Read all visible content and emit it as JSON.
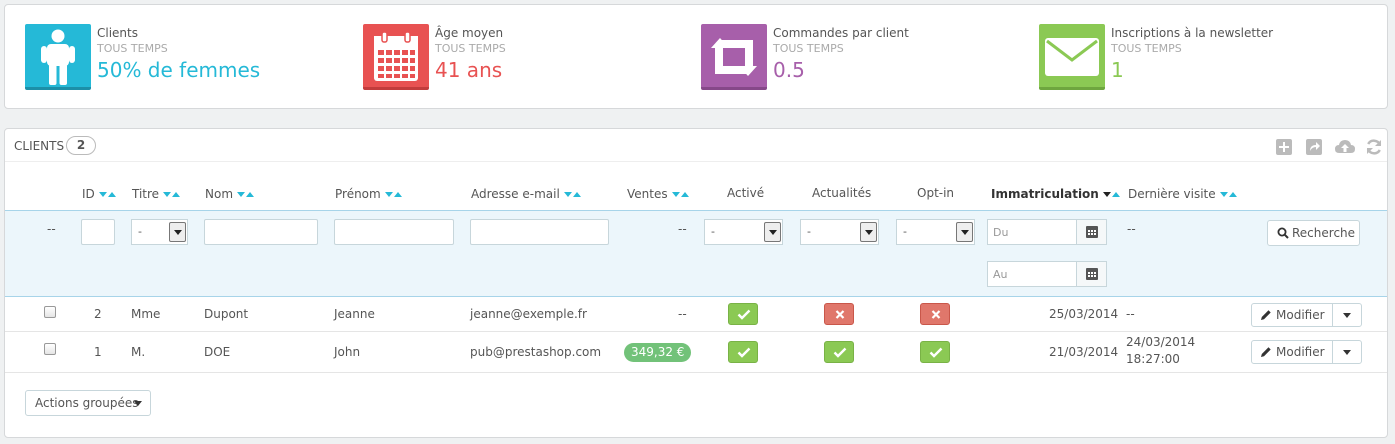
{
  "kpis": [
    {
      "title": "Clients",
      "period": "TOUS TEMPS",
      "value": "50% de femmes",
      "color": "#25b9d7",
      "icon": "user-icon"
    },
    {
      "title": "Âge moyen",
      "period": "TOUS TEMPS",
      "value": "41 ans",
      "color": "#e85252",
      "icon": "calendar-icon"
    },
    {
      "title": "Commandes par client",
      "period": "TOUS TEMPS",
      "value": "0.5",
      "color": "#a75faa",
      "icon": "retweet-icon"
    },
    {
      "title": "Inscriptions à la newsletter",
      "period": "TOUS TEMPS",
      "value": "1",
      "color": "#8bc954",
      "icon": "envelope-icon"
    }
  ],
  "panel": {
    "title": "CLIENTS",
    "count": "2",
    "toolbar": [
      "add-icon",
      "export-icon",
      "cloud-upload-icon",
      "refresh-icon"
    ]
  },
  "columns": {
    "id": "ID",
    "title": "Titre",
    "lastname": "Nom",
    "firstname": "Prénom",
    "email": "Adresse e-mail",
    "sales": "Ventes",
    "active": "Activé",
    "news": "Actualités",
    "optin": "Opt-in",
    "registration": "Immatriculation",
    "last_visit": "Dernière visite"
  },
  "filters": {
    "placeholder_dash": "--",
    "title_select": "-",
    "active_select": "-",
    "news_select": "-",
    "optin_select": "-",
    "sales_dash": "--",
    "date_from": "Du",
    "date_to": "Au",
    "last_visit_dash": "--",
    "search_label": "Recherche"
  },
  "rows": [
    {
      "id": "2",
      "title": "Mme",
      "lastname": "Dupont",
      "firstname": "Jeanne",
      "email": "jeanne@exemple.fr",
      "sales": "--",
      "active": true,
      "news": false,
      "optin": false,
      "registration": "25/03/2014",
      "last_visit": "--",
      "last_visit_time": "",
      "edit_label": "Modifier"
    },
    {
      "id": "1",
      "title": "M.",
      "lastname": "DOE",
      "firstname": "John",
      "email": "pub@prestashop.com",
      "sales": "349,32 €",
      "active": true,
      "news": true,
      "optin": true,
      "registration": "21/03/2014",
      "last_visit": "24/03/2014",
      "last_visit_time": "18:27:00",
      "edit_label": "Modifier"
    }
  ],
  "bulk_actions_label": "Actions groupées"
}
